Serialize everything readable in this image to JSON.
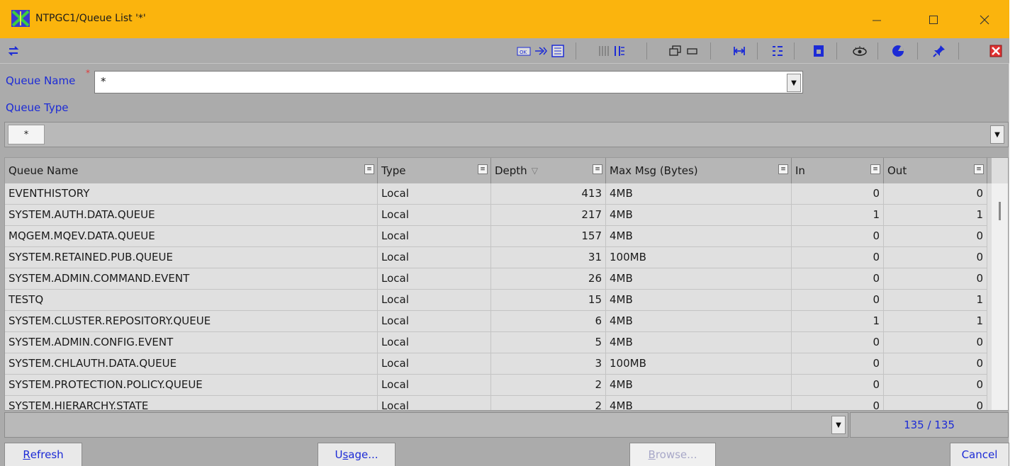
{
  "window": {
    "title": "NTPGC1/Queue List '*'",
    "minimize_icon": "minimize-icon",
    "maximize_icon": "maximize-icon",
    "close_icon": "close-icon"
  },
  "toolbar": {
    "icons": [
      "refresh-arrows-icon",
      "ok-button-icon",
      "flow-icon",
      "list-view-icon",
      "columns-icon",
      "fields-icon",
      "window-icon",
      "bar-icon",
      "fit-width-icon",
      "tree-list-icon",
      "lock-icon",
      "eye-icon",
      "pie-chart-icon",
      "pin-icon",
      "exit-icon"
    ]
  },
  "filters": {
    "queue_name_label": "Queue Name",
    "queue_name_required": "*",
    "queue_name_value": "*",
    "queue_type_label": "Queue Type",
    "queue_type_chip": "*"
  },
  "grid": {
    "columns": [
      "Queue Name",
      "Type",
      "Depth",
      "Max Msg (Bytes)",
      "In",
      "Out"
    ],
    "sort_indicator": "▽",
    "rows": [
      [
        "EVENTHISTORY",
        "Local",
        "413",
        "4MB",
        "0",
        "0"
      ],
      [
        "SYSTEM.AUTH.DATA.QUEUE",
        "Local",
        "217",
        "4MB",
        "1",
        "1"
      ],
      [
        "MQGEM.MQEV.DATA.QUEUE",
        "Local",
        "157",
        "4MB",
        "0",
        "0"
      ],
      [
        "SYSTEM.RETAINED.PUB.QUEUE",
        "Local",
        "31",
        "100MB",
        "0",
        "0"
      ],
      [
        "SYSTEM.ADMIN.COMMAND.EVENT",
        "Local",
        "26",
        "4MB",
        "0",
        "0"
      ],
      [
        "TESTQ",
        "Local",
        "15",
        "4MB",
        "0",
        "1"
      ],
      [
        "SYSTEM.CLUSTER.REPOSITORY.QUEUE",
        "Local",
        "6",
        "4MB",
        "1",
        "1"
      ],
      [
        "SYSTEM.ADMIN.CONFIG.EVENT",
        "Local",
        "5",
        "4MB",
        "0",
        "0"
      ],
      [
        "SYSTEM.CHLAUTH.DATA.QUEUE",
        "Local",
        "3",
        "100MB",
        "0",
        "0"
      ],
      [
        "SYSTEM.PROTECTION.POLICY.QUEUE",
        "Local",
        "2",
        "4MB",
        "0",
        "0"
      ],
      [
        "SYSTEM.HIERARCHY.STATE",
        "Local",
        "2",
        "4MB",
        "0",
        "0"
      ]
    ]
  },
  "footer": {
    "count": "135 / 135",
    "refresh_pre": "",
    "refresh_u": "R",
    "refresh_post": "efresh",
    "usage_pre": "U",
    "usage_u": "s",
    "usage_post": "age...",
    "browse_pre": "",
    "browse_u": "B",
    "browse_post": "rowse...",
    "cancel": "Cancel"
  },
  "colors": {
    "title_bar": "#fbb40d",
    "label_blue": "#1c2bd6",
    "required": "#e03a3a"
  }
}
